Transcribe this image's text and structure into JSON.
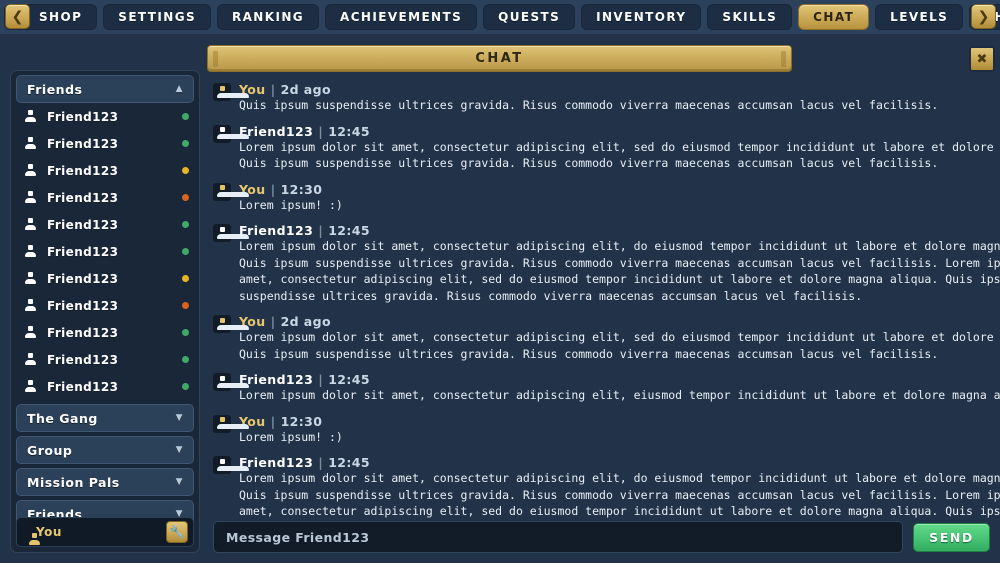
{
  "topnav": {
    "back_icon": "chevron-left-icon",
    "forward_icon": "chevron-right-icon",
    "tabs": [
      {
        "label": "SHOP",
        "active": false
      },
      {
        "label": "SETTINGS",
        "active": false
      },
      {
        "label": "RANKING",
        "active": false
      },
      {
        "label": "ACHIEVEMENTS",
        "active": false
      },
      {
        "label": "QUESTS",
        "active": false
      },
      {
        "label": "INVENTORY",
        "active": false
      },
      {
        "label": "SKILLS",
        "active": false
      },
      {
        "label": "CHAT",
        "active": true
      },
      {
        "label": "LEVELS",
        "active": false
      },
      {
        "label": "CHARACTER",
        "active": false
      }
    ]
  },
  "sidebar": {
    "groups": [
      {
        "label": "Friends",
        "expanded": true,
        "chevron": "chevron-up-icon"
      },
      {
        "label": "The Gang",
        "expanded": false,
        "chevron": "chevron-down-icon"
      },
      {
        "label": "Group",
        "expanded": false,
        "chevron": "chevron-down-icon"
      },
      {
        "label": "Mission Pals",
        "expanded": false,
        "chevron": "chevron-down-icon"
      },
      {
        "label": "Friends",
        "expanded": false,
        "chevron": "chevron-down-icon"
      }
    ],
    "friends": [
      {
        "name": "Friend123",
        "status": "online"
      },
      {
        "name": "Friend123",
        "status": "online"
      },
      {
        "name": "Friend123",
        "status": "away"
      },
      {
        "name": "Friend123",
        "status": "busy"
      },
      {
        "name": "Friend123",
        "status": "online"
      },
      {
        "name": "Friend123",
        "status": "online"
      },
      {
        "name": "Friend123",
        "status": "away"
      },
      {
        "name": "Friend123",
        "status": "busy"
      },
      {
        "name": "Friend123",
        "status": "online"
      },
      {
        "name": "Friend123",
        "status": "online"
      },
      {
        "name": "Friend123",
        "status": "online"
      }
    ],
    "status_colors": {
      "online": "#3fa96a",
      "away": "#e7b523",
      "busy": "#d9631f"
    },
    "self": {
      "label": "You",
      "avatar_icon": "user-icon",
      "settings_icon": "wrench-icon"
    }
  },
  "chat_panel": {
    "title": "CHAT",
    "close_icon": "close-icon",
    "messages": [
      {
        "author": "You",
        "self": true,
        "time": "2d ago",
        "text": "Quis ipsum suspendisse ultrices gravida. Risus commodo viverra maecenas accumsan lacus vel facilisis."
      },
      {
        "author": "Friend123",
        "self": false,
        "time": "12:45",
        "text": "Lorem ipsum dolor sit amet, consectetur adipiscing elit, sed do eiusmod tempor incididunt ut labore et dolore magna aliqua.\nQuis ipsum suspendisse ultrices gravida. Risus commodo viverra maecenas accumsan lacus vel facilisis."
      },
      {
        "author": "You",
        "self": true,
        "time": "12:30",
        "text": "Lorem ipsum! :)"
      },
      {
        "author": "Friend123",
        "self": false,
        "time": "12:45",
        "text": "Lorem ipsum dolor sit amet, consectetur adipiscing elit, do eiusmod tempor incididunt ut labore et dolore magna aliqua.\nQuis ipsum suspendisse ultrices gravida. Risus commodo viverra maecenas accumsan lacus vel facilisis. Lorem ipsum dolor\namet, consectetur adipiscing elit, sed do eiusmod tempor incididunt ut labore et dolore magna aliqua. Quis ipsum\nsuspendisse ultrices gravida. Risus commodo viverra maecenas accumsan lacus vel facilisis."
      },
      {
        "author": "You",
        "self": true,
        "time": "2d ago",
        "text": "Lorem ipsum dolor sit amet, consectetur adipiscing elit, sed do eiusmod tempor incididunt ut labore et dolore magna aliqua.\nQuis ipsum suspendisse ultrices gravida. Risus commodo viverra maecenas accumsan lacus vel facilisis."
      },
      {
        "author": "Friend123",
        "self": false,
        "time": "12:45",
        "text": "Lorem ipsum dolor sit amet, consectetur adipiscing elit, eiusmod tempor incididunt ut labore et dolore magna aliqua?"
      },
      {
        "author": "You",
        "self": true,
        "time": "12:30",
        "text": "Lorem ipsum! :)"
      },
      {
        "author": "Friend123",
        "self": false,
        "time": "12:45",
        "text": "Lorem ipsum dolor sit amet, consectetur adipiscing elit, do eiusmod tempor incididunt ut labore et dolore magna aliqua.\nQuis ipsum suspendisse ultrices gravida. Risus commodo viverra maecenas accumsan lacus vel facilisis. Lorem ipsum dolor\namet, consectetur adipiscing elit, sed do eiusmod tempor incididunt ut labore et dolore magna aliqua. Quis ipsum\nsuspendisse ultrices gravida. Risus commodo viverra maecenas accumsan lacus vel facilisis."
      }
    ]
  },
  "composer": {
    "placeholder": "Message Friend123",
    "value": "",
    "send_label": "SEND"
  }
}
